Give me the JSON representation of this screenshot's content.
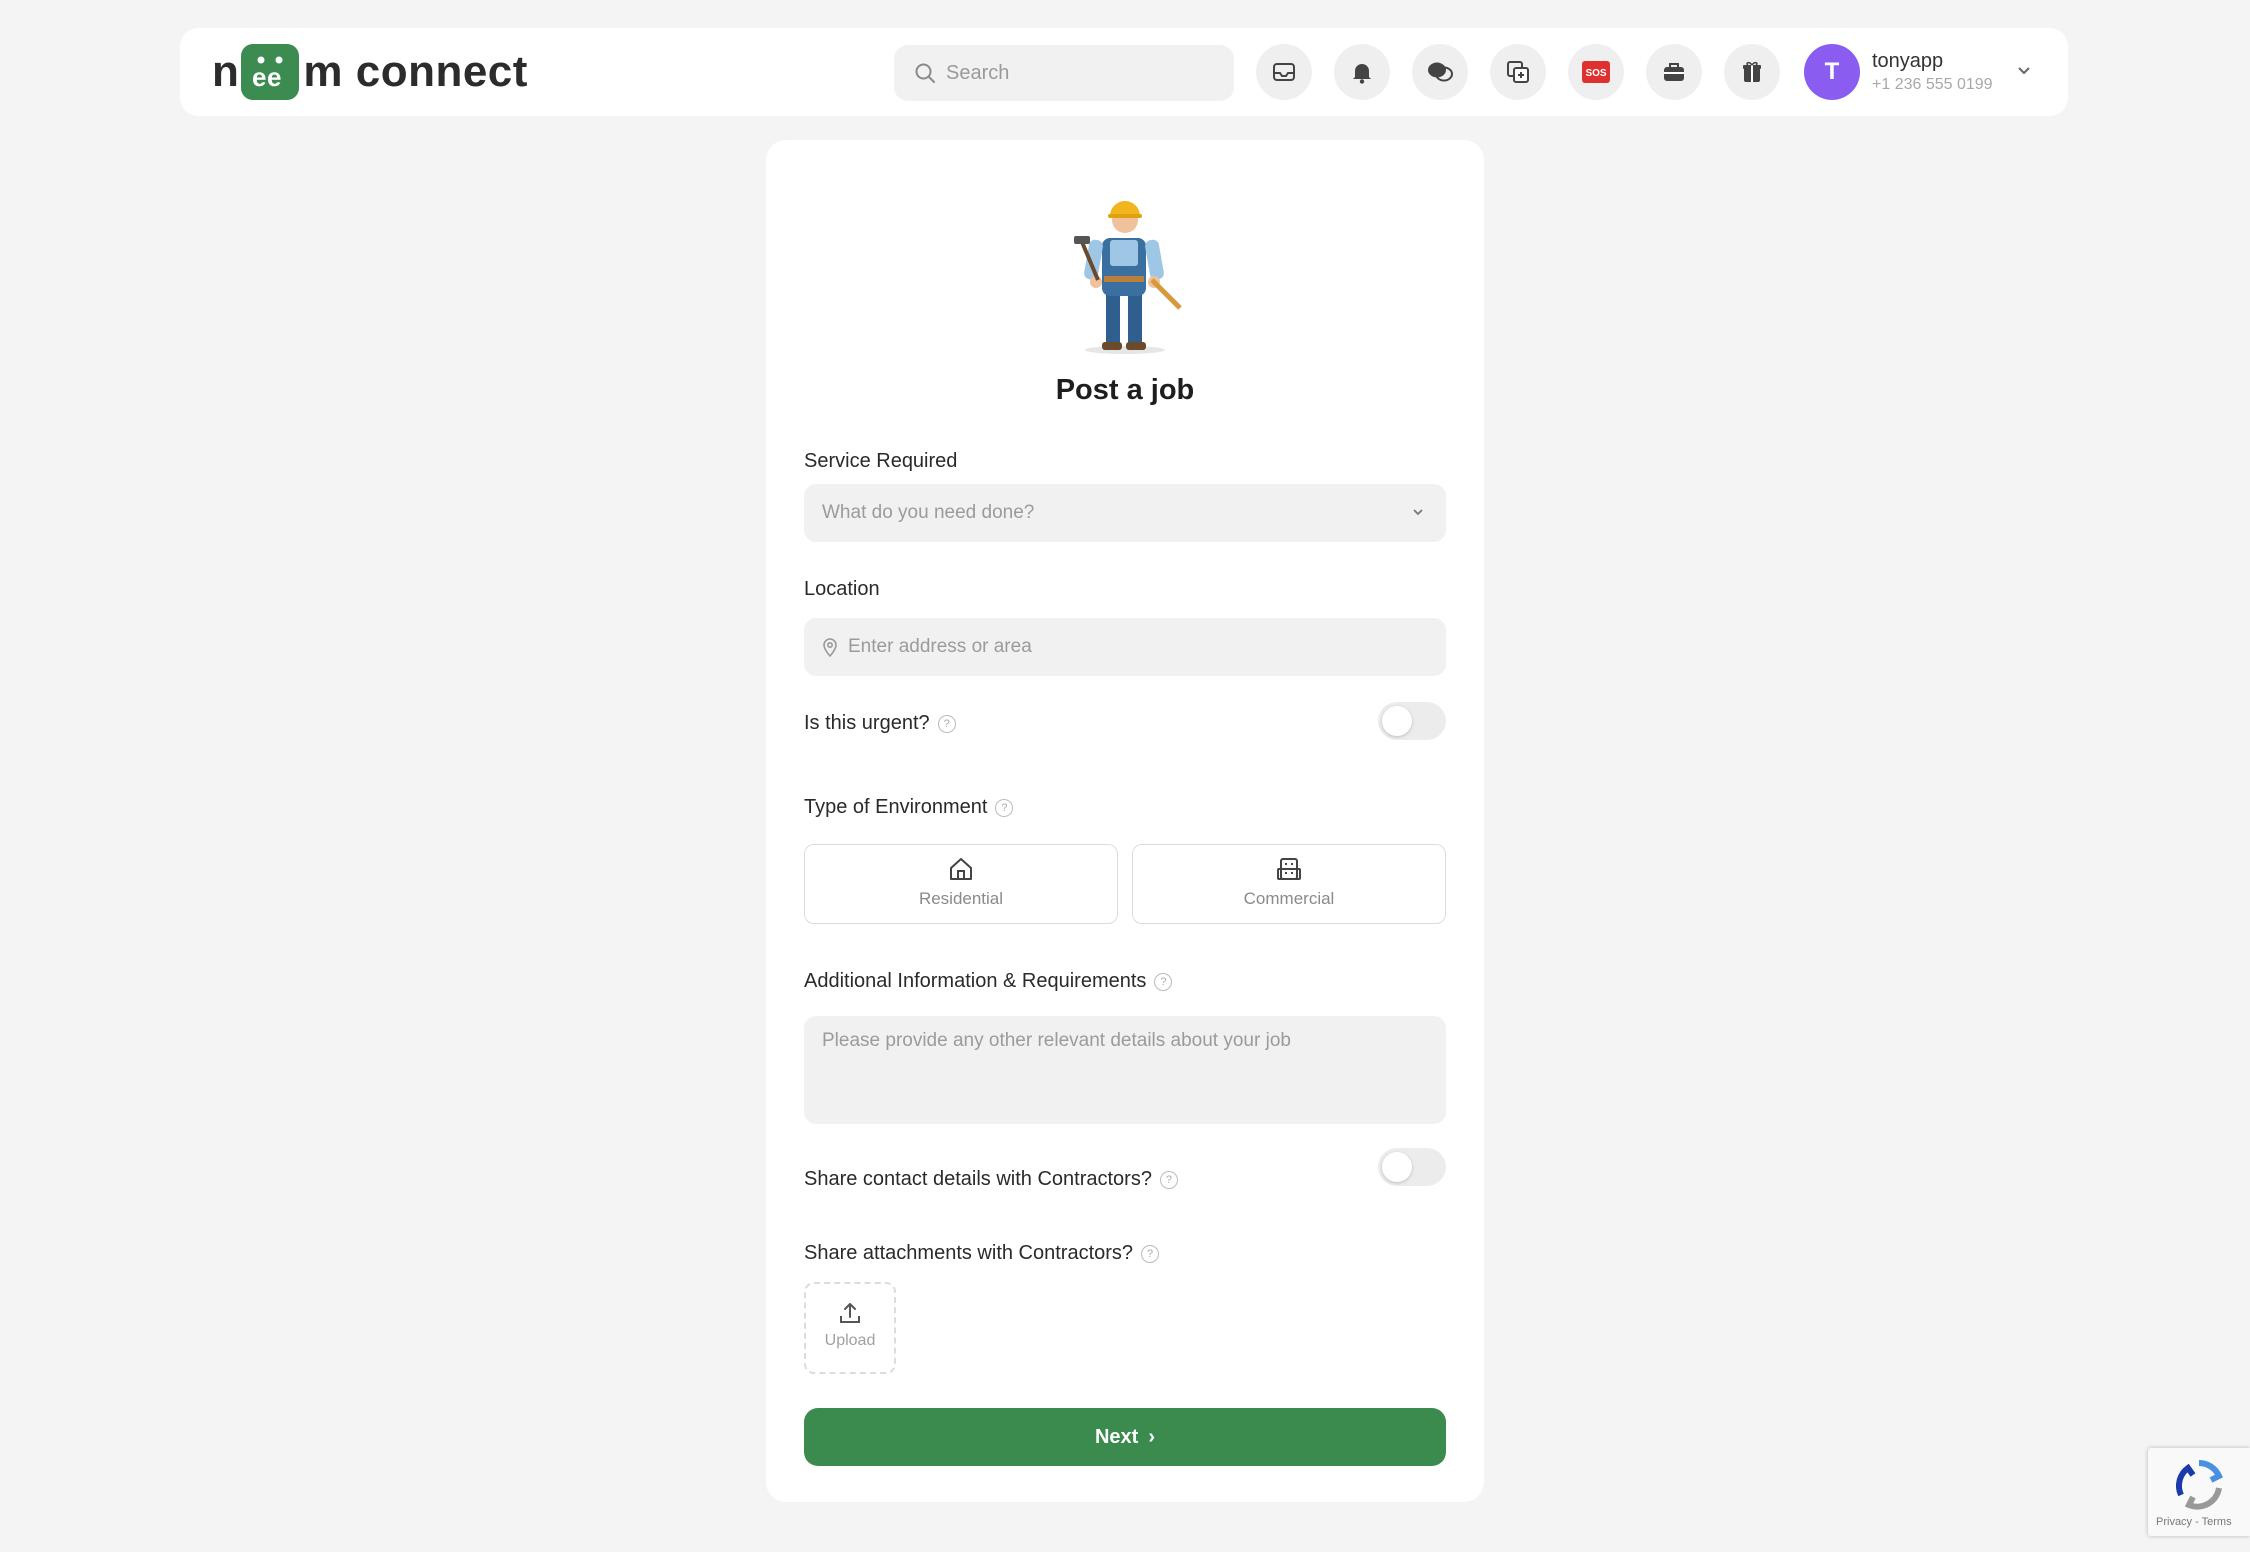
{
  "brand": {
    "logo_prefix": "n",
    "logo_badge": "ee",
    "logo_suffix": "m connect",
    "accent_color": "#3c8b50"
  },
  "header": {
    "search_placeholder": "Search",
    "icons": [
      "inbox-icon",
      "bell-icon",
      "chat-icon",
      "copy-icon",
      "sos-icon",
      "briefcase-icon",
      "gift-icon"
    ],
    "sos_label": "SOS",
    "user": {
      "initial": "T",
      "name": "tonyapp",
      "phone": "+1 236 555 0199",
      "avatar_color": "#8a5cf0"
    }
  },
  "form": {
    "title": "Post a job",
    "service": {
      "label": "Service Required",
      "placeholder": "What do you need done?"
    },
    "location": {
      "label": "Location",
      "placeholder": "Enter address or area"
    },
    "urgent": {
      "label": "Is this urgent?",
      "value": false
    },
    "environment": {
      "label": "Type of Environment",
      "options": [
        "Residential",
        "Commercial"
      ]
    },
    "additional": {
      "label": "Additional Information & Requirements",
      "placeholder": "Please provide any other relevant details about your job"
    },
    "share_contact": {
      "label": "Share contact details with Contractors?",
      "value": false
    },
    "attachments": {
      "label": "Share attachments with Contractors?",
      "upload_label": "Upload"
    },
    "next_label": "Next"
  },
  "recaptcha": {
    "footer": "Privacy - Terms"
  }
}
